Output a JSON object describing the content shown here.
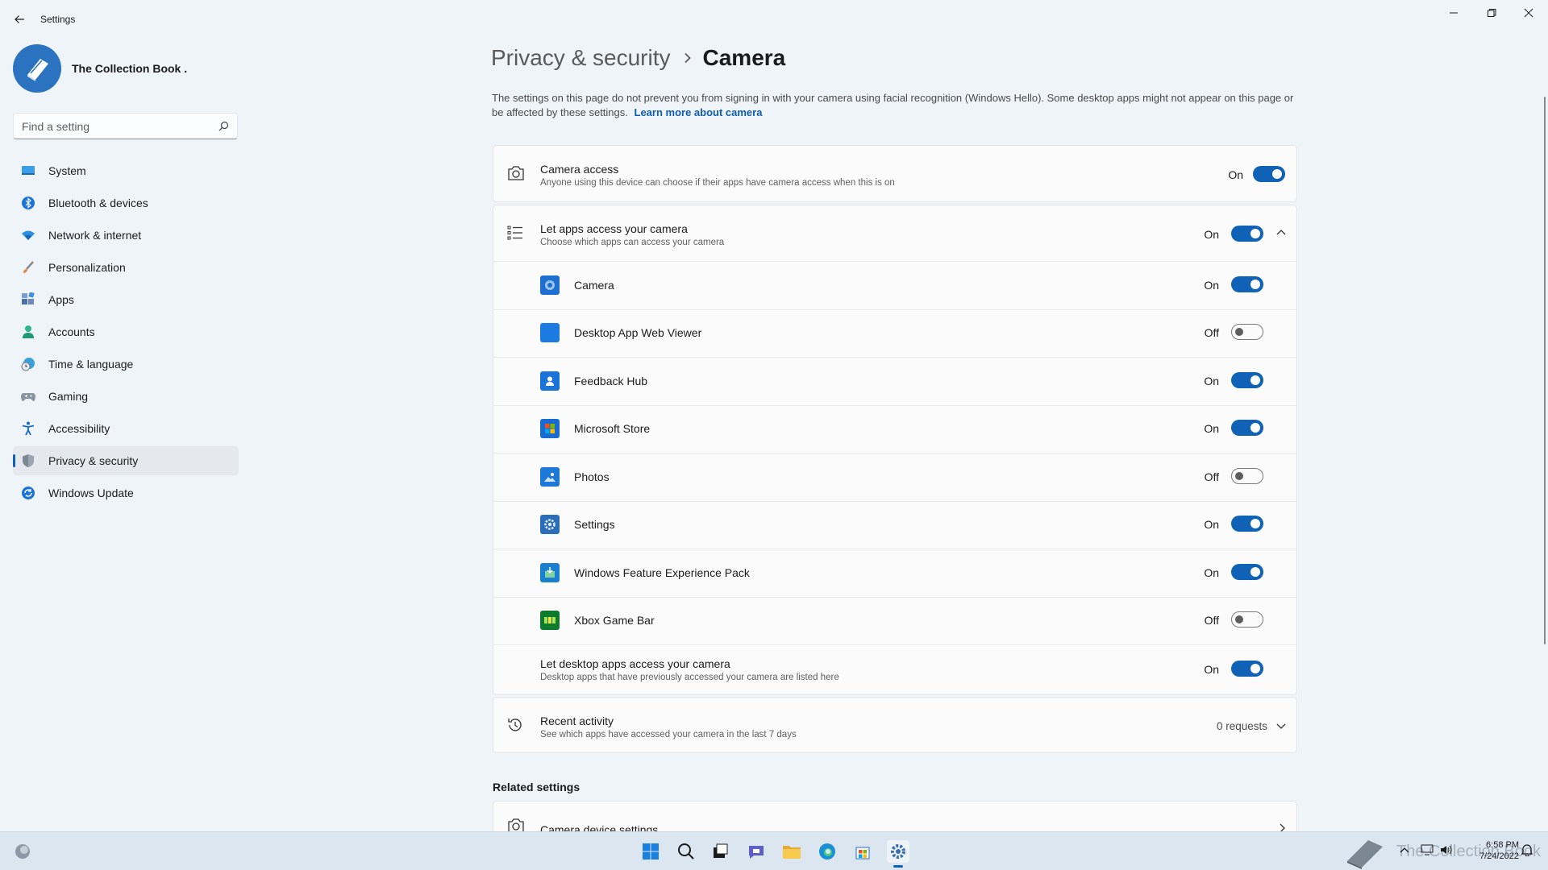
{
  "window": {
    "title": "Settings"
  },
  "profile": {
    "name": "The Collection Book ."
  },
  "search": {
    "placeholder": "Find a setting"
  },
  "nav": [
    {
      "label": "System",
      "icon": "system-icon"
    },
    {
      "label": "Bluetooth & devices",
      "icon": "bluetooth-icon"
    },
    {
      "label": "Network & internet",
      "icon": "wifi-icon"
    },
    {
      "label": "Personalization",
      "icon": "brush-icon"
    },
    {
      "label": "Apps",
      "icon": "apps-icon"
    },
    {
      "label": "Accounts",
      "icon": "person-icon"
    },
    {
      "label": "Time & language",
      "icon": "clock-globe-icon"
    },
    {
      "label": "Gaming",
      "icon": "gamepad-icon"
    },
    {
      "label": "Accessibility",
      "icon": "accessibility-icon"
    },
    {
      "label": "Privacy & security",
      "icon": "shield-icon",
      "active": true
    },
    {
      "label": "Windows Update",
      "icon": "update-icon"
    }
  ],
  "breadcrumb": {
    "parent": "Privacy & security",
    "current": "Camera"
  },
  "description": {
    "text": "The settings on this page do not prevent you from signing in with your camera using facial recognition (Windows Hello). Some desktop apps might not appear on this page or be affected by these settings.",
    "link": "Learn more about camera"
  },
  "camera_access": {
    "title": "Camera access",
    "subtitle": "Anyone using this device can choose if their apps have camera access when this is on",
    "state": "On"
  },
  "let_apps": {
    "title": "Let apps access your camera",
    "subtitle": "Choose which apps can access your camera",
    "state": "On"
  },
  "apps": [
    {
      "name": "Camera",
      "state": "On",
      "icon": "camera-app-icon",
      "color": "#1e6fd0"
    },
    {
      "name": "Desktop App Web Viewer",
      "state": "Off",
      "icon": "web-viewer-icon",
      "color": "#1c7be0"
    },
    {
      "name": "Feedback Hub",
      "state": "On",
      "icon": "feedback-hub-icon",
      "color": "#1a73d9"
    },
    {
      "name": "Microsoft Store",
      "state": "On",
      "icon": "store-icon",
      "color": "#1a6bd0"
    },
    {
      "name": "Photos",
      "state": "Off",
      "icon": "photos-icon",
      "color": "#1e78d8"
    },
    {
      "name": "Settings",
      "state": "On",
      "icon": "settings-app-icon",
      "color": "#2a6db8"
    },
    {
      "name": "Windows Feature Experience Pack",
      "state": "On",
      "icon": "feature-pack-icon",
      "color": "#1a80d0"
    },
    {
      "name": "Xbox Game Bar",
      "state": "Off",
      "icon": "xbox-game-bar-icon",
      "color": "#0e7a2c"
    }
  ],
  "desktop_apps": {
    "title": "Let desktop apps access your camera",
    "subtitle": "Desktop apps that have previously accessed your camera are listed here",
    "state": "On"
  },
  "recent": {
    "title": "Recent activity",
    "subtitle": "See which apps have accessed your camera in the last 7 days",
    "value": "0 requests"
  },
  "related": {
    "heading": "Related settings",
    "camera_device": "Camera device settings"
  },
  "taskbar": {
    "time": "6:58 PM",
    "date": "7/24/2022",
    "watermark": "The Collection Book"
  }
}
